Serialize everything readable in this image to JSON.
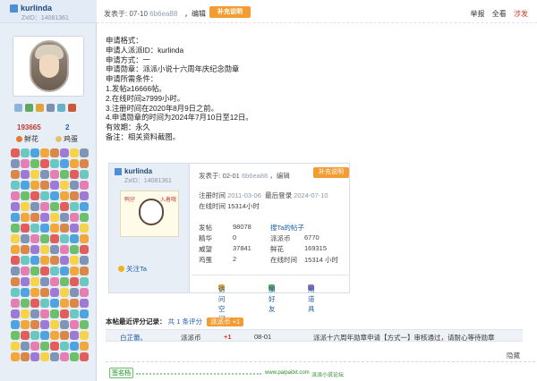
{
  "user": {
    "name": "kurlinda",
    "uid": "ZxID：14081361",
    "stat_a_value": "193665",
    "stat_b_value": "2",
    "stat_a_label": "鲜花",
    "stat_b_label": "鸡蛋"
  },
  "post_header": {
    "time": "发表于: 07-10",
    "device": "6b6ea88",
    "edit": "，编辑",
    "supplement_button": "补充说明",
    "report": "举报",
    "view_all": "全看",
    "vs": "涉发"
  },
  "post_body": {
    "lines": [
      "申请格式：",
      "申请人派派ID：kurlinda",
      "申请方式：一",
      "申请勋章：派派小说十六周年庆纪念勋章",
      "申请所需条件：",
      "1.发帖≥16666帖。",
      "2.在线时间≥7999小时。",
      "3.注册时间在2020年8月9日之前。",
      "4.申请勋章的时间为2024年7月10日至12日。",
      "有效期：永久",
      "备注：相关资料截图。"
    ]
  },
  "embed": {
    "name": "kurlinda",
    "uid": "ZxID：14081361",
    "time": "发表于: 02-01",
    "device": "6b6ea88",
    "edit": "，编辑",
    "supplement_button": "补充说明",
    "avatar_caption_1": "鸭仔",
    "avatar_caption_2": "入着哦",
    "follow": "关注Ta",
    "register_label": "注册时间",
    "register_value": "2011-03-06",
    "last_login_label": "最后登录",
    "last_login_value": "2024-07-10",
    "online_label": "在线时间",
    "online_value": "15314小时",
    "stats": [
      {
        "l1": "发帖",
        "v1": "98078",
        "l2": "搜Ta的帖子",
        "v2": ""
      },
      {
        "l1": "精华",
        "v1": "0",
        "l2": "派派币",
        "v2": "6770"
      },
      {
        "l1": "威望",
        "v1": "37841",
        "l2": "鲜花",
        "v2": "169315"
      },
      {
        "l1": "鸡蛋",
        "v1": "2",
        "l2": "在线时间",
        "v2": "15314 小时"
      }
    ],
    "bar_visit": "访问空间",
    "bar_add": "加好友",
    "bar_props": "用道具"
  },
  "rating": {
    "title": "本帖最近评分记录：",
    "count_prefix": "共",
    "count": "1",
    "count_suffix": "条评分",
    "badge": "派派币 +1",
    "row": {
      "user": "白芷蕾。",
      "field": "派派币",
      "value": "+1",
      "date": "08-01",
      "reason": "派派十六周年勋章申请【方式一】审核通过，请耐心等待勋章"
    }
  },
  "hide_label": "隐藏",
  "signature": {
    "label": "签名档",
    "url": "www.paipaitxt.com",
    "text": "派派小说论坛"
  },
  "colors": {
    "accent": "#f39c32",
    "link": "#1d5fa8",
    "alert": "#d23b2b",
    "sidebar_bg": "#e8eef6"
  }
}
